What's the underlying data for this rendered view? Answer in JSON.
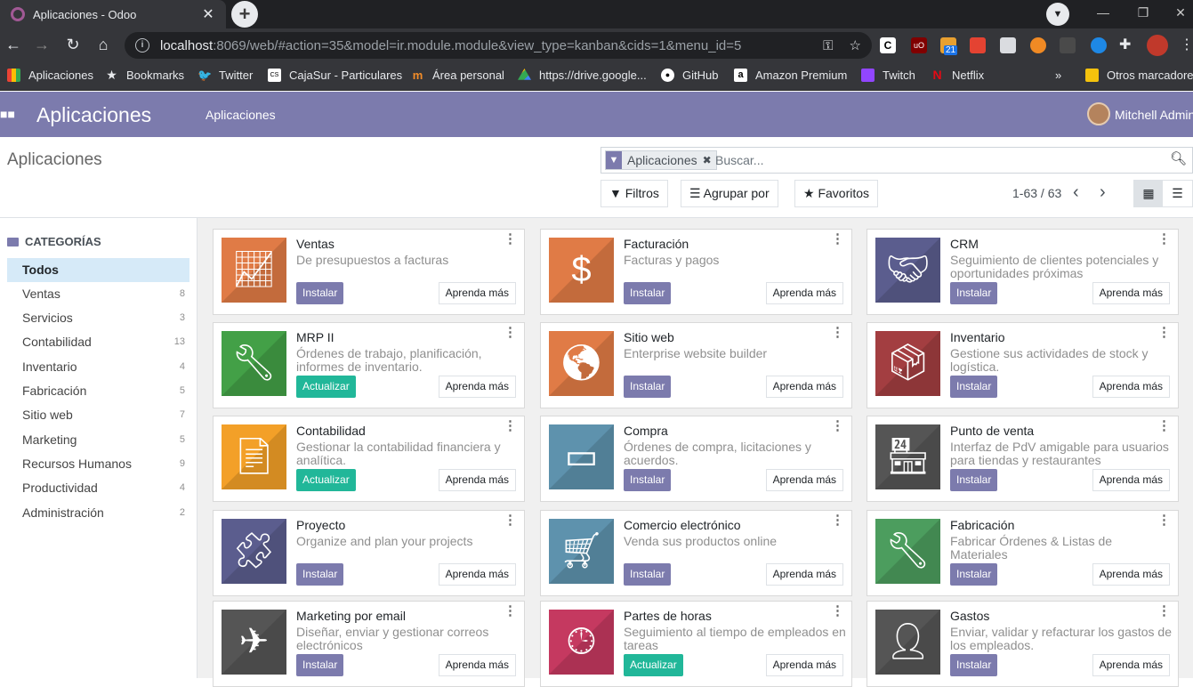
{
  "browser": {
    "tab_title": "Aplicaciones - Odoo",
    "new_tab": "+",
    "url_host": "localhost",
    "url_rest": ":8069/web/#action=35&model=ir.module.module&view_type=kanban&cids=1&menu_id=5",
    "ext_badge": "21",
    "bookmarks": [
      "Aplicaciones",
      "Bookmarks",
      "Twitter",
      "CajaSur - Particulares",
      "Área personal",
      "https://drive.google...",
      "GitHub",
      "Amazon Premium",
      "Twitch",
      "Netflix"
    ],
    "bookmarks_overflow": "»",
    "other_bookmarks": "Otros marcadores"
  },
  "odoo_nav": {
    "brand": "Aplicaciones",
    "menu": "Aplicaciones",
    "user": "Mitchell Admin"
  },
  "control": {
    "breadcrumb": "Aplicaciones",
    "facet": "Aplicaciones",
    "search_placeholder": "Buscar...",
    "filters": "Filtros",
    "group_by": "Agrupar por",
    "favorites": "Favoritos",
    "pager": "1-63 / 63"
  },
  "sidebar": {
    "heading": "CATEGORÍAS",
    "items": [
      {
        "label": "Todos",
        "count": ""
      },
      {
        "label": "Ventas",
        "count": "8"
      },
      {
        "label": "Servicios",
        "count": "3"
      },
      {
        "label": "Contabilidad",
        "count": "13"
      },
      {
        "label": "Inventario",
        "count": "4"
      },
      {
        "label": "Fabricación",
        "count": "5"
      },
      {
        "label": "Sitio web",
        "count": "7"
      },
      {
        "label": "Marketing",
        "count": "5"
      },
      {
        "label": "Recursos Humanos",
        "count": "9"
      },
      {
        "label": "Productividad",
        "count": "4"
      },
      {
        "label": "Administración",
        "count": "2"
      }
    ]
  },
  "learn_label": "Aprenda más",
  "apps": [
    {
      "title": "Ventas",
      "desc": "De presupuestos a facturas",
      "action": "Instalar",
      "color": "#e07b46",
      "icon": "chart-up-icon"
    },
    {
      "title": "Facturación",
      "desc": "Facturas y pagos",
      "action": "Instalar",
      "color": "#e07b46",
      "icon": "invoice-icon"
    },
    {
      "title": "CRM",
      "desc": "Seguimiento de clientes potenciales y oportunidades próximas",
      "action": "Instalar",
      "color": "#5b5d8e",
      "icon": "handshake-icon"
    },
    {
      "title": "MRP II",
      "desc": "Órdenes de trabajo, planificación, informes de inventario.",
      "action": "Actualizar",
      "color": "#43a047",
      "icon": "wrench-icon"
    },
    {
      "title": "Sitio web",
      "desc": "Enterprise website builder",
      "action": "Instalar",
      "color": "#e07b46",
      "icon": "globe-icon"
    },
    {
      "title": "Inventario",
      "desc": "Gestione sus actividades de stock y logística.",
      "action": "Instalar",
      "color": "#a33e41",
      "icon": "box-icon"
    },
    {
      "title": "Contabilidad",
      "desc": "Gestionar la contabilidad financiera y analítica.",
      "action": "Actualizar",
      "color": "#f3a028",
      "icon": "document-icon"
    },
    {
      "title": "Compra",
      "desc": "Órdenes de compra, licitaciones y acuerdos.",
      "action": "Instalar",
      "color": "#5e92ad",
      "icon": "credit-card-icon"
    },
    {
      "title": "Punto de venta",
      "desc": "Interfaz de PdV amigable para usuarios para tiendas y restaurantes",
      "action": "Instalar",
      "color": "#555555",
      "icon": "store-icon"
    },
    {
      "title": "Proyecto",
      "desc": "Organize and plan your projects",
      "action": "Instalar",
      "color": "#5b5d8e",
      "icon": "puzzle-icon"
    },
    {
      "title": "Comercio electrónico",
      "desc": "Venda sus productos online",
      "action": "Instalar",
      "color": "#5e92ad",
      "icon": "cart-icon"
    },
    {
      "title": "Fabricación",
      "desc": "Fabricar Órdenes & Listas de Materiales",
      "action": "Instalar",
      "color": "#4c9d5e",
      "icon": "wrench-icon"
    },
    {
      "title": "Marketing por email",
      "desc": "Diseñar, enviar y gestionar correos electrónicos",
      "action": "Instalar",
      "color": "#555555",
      "icon": "paper-plane-icon"
    },
    {
      "title": "Partes de horas",
      "desc": "Seguimiento al tiempo de empleados en tareas",
      "action": "Actualizar",
      "color": "#c53960",
      "icon": "clock-icon"
    },
    {
      "title": "Gastos",
      "desc": "Enviar, validar y refacturar los gastos de los empleados.",
      "action": "Instalar",
      "color": "#555555",
      "icon": "person-dollar-icon"
    }
  ]
}
